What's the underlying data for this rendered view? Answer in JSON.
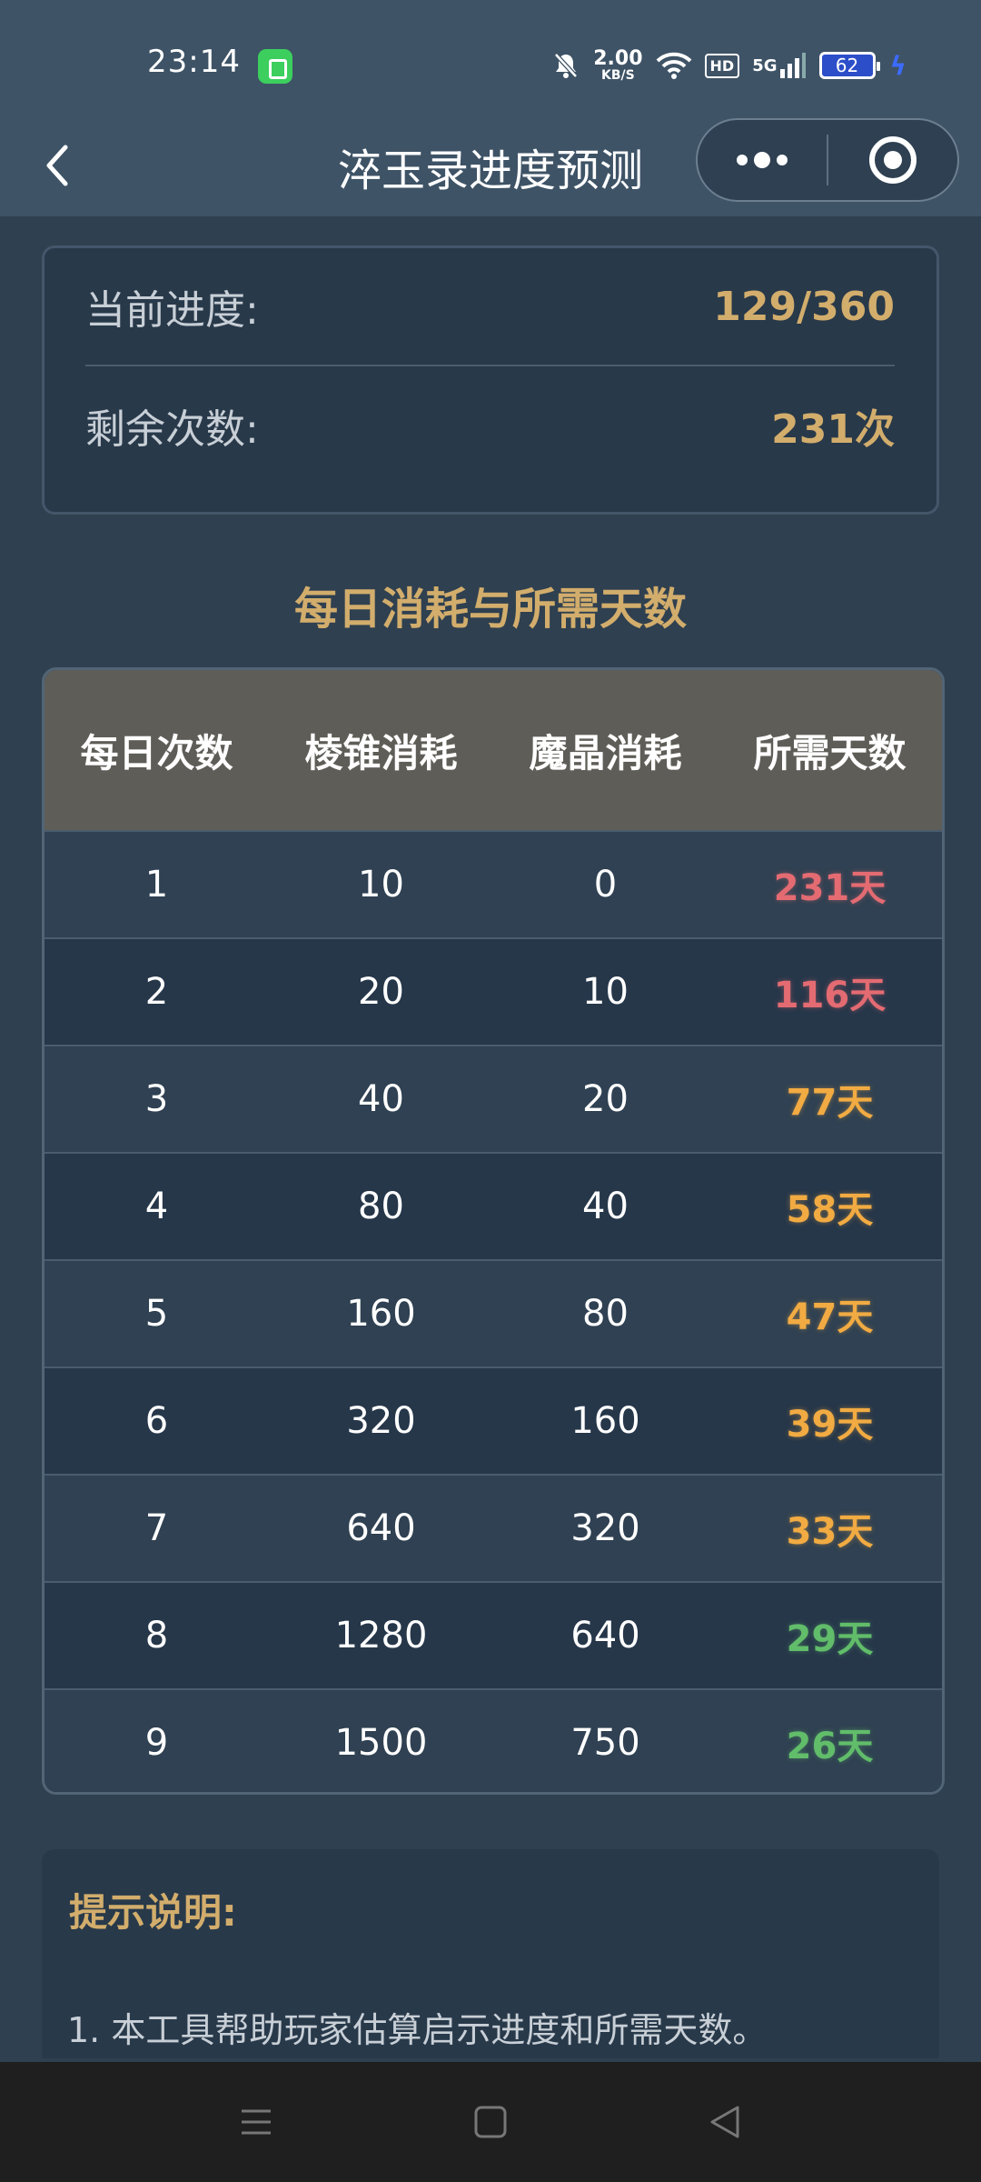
{
  "status_bar": {
    "time": "23:14",
    "speed_value": "2.00",
    "speed_unit": "KB/S",
    "hd_label": "HD",
    "network_label": "5G",
    "battery_level": "62",
    "icons": [
      "app-notification-icon",
      "mute-icon",
      "wifi-icon",
      "signal-icon",
      "battery-icon",
      "charging-icon"
    ]
  },
  "header": {
    "title": "淬玉录进度预测",
    "back_icon": "chevron-left-icon",
    "more_icon": "more-dots-icon",
    "close_icon": "target-close-icon"
  },
  "progress_card": {
    "current_label": "当前进度:",
    "current_value": "129/360",
    "remaining_label": "剩余次数:",
    "remaining_value": "231次"
  },
  "section_title": "每日消耗与所需天数",
  "table": {
    "headers": [
      "每日次数",
      "棱锥消耗",
      "魔晶消耗",
      "所需天数"
    ],
    "rows": [
      {
        "times": "1",
        "pyramid": "10",
        "crystal": "0",
        "days": "231天",
        "level": "red"
      },
      {
        "times": "2",
        "pyramid": "20",
        "crystal": "10",
        "days": "116天",
        "level": "red"
      },
      {
        "times": "3",
        "pyramid": "40",
        "crystal": "20",
        "days": "77天",
        "level": "orange"
      },
      {
        "times": "4",
        "pyramid": "80",
        "crystal": "40",
        "days": "58天",
        "level": "orange"
      },
      {
        "times": "5",
        "pyramid": "160",
        "crystal": "80",
        "days": "47天",
        "level": "orange"
      },
      {
        "times": "6",
        "pyramid": "320",
        "crystal": "160",
        "days": "39天",
        "level": "orange"
      },
      {
        "times": "7",
        "pyramid": "640",
        "crystal": "320",
        "days": "33天",
        "level": "orange"
      },
      {
        "times": "8",
        "pyramid": "1280",
        "crystal": "640",
        "days": "29天",
        "level": "green"
      },
      {
        "times": "9",
        "pyramid": "1500",
        "crystal": "750",
        "days": "26天",
        "level": "green"
      }
    ]
  },
  "notes": {
    "title": "提示说明:",
    "line1": "1. 本工具帮助玩家估算启示进度和所需天数。"
  },
  "colors": {
    "background": "#2f4050",
    "accent_gold": "#d2ad6c",
    "red": "#e46b72",
    "orange": "#f1ab42",
    "green": "#61bd6a"
  }
}
